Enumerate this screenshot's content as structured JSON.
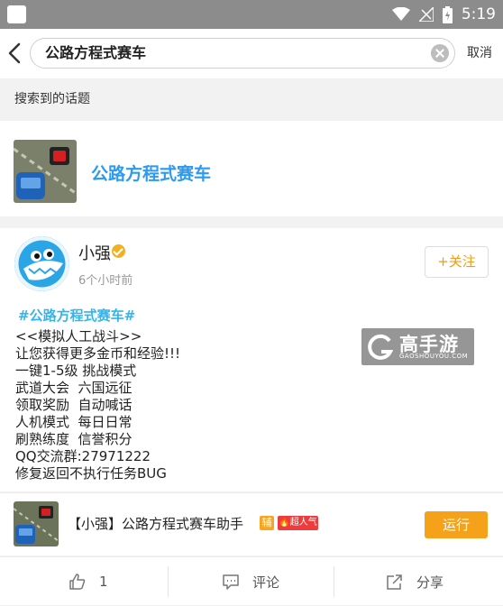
{
  "status_bar": {
    "time": "5:19"
  },
  "search": {
    "query": "公路方程式赛车",
    "cancel_label": "取消"
  },
  "section": {
    "label": "搜索到的话题"
  },
  "topic": {
    "title": "公路方程式赛车"
  },
  "post": {
    "author": "小强",
    "time": "6个小时前",
    "follow_label": "+关注",
    "hashtag": "#公路方程式赛车#",
    "lines": [
      "<<模拟人工战斗>>",
      "让您获得更多金币和经验!!!",
      "一键1-5级 挑战模式",
      "武道大会  六国远征",
      "领取奖励  自动喊话",
      "人机模式  每日日常",
      "刷熟练度  信誉积分",
      "QQ交流群:27971222",
      "修复返回不执行任务BUG"
    ],
    "watermark": {
      "name": "高手游",
      "sub": "GAOSHOUYOU.COM"
    }
  },
  "app": {
    "name": "【小强】公路方程式赛车助手",
    "badge_fu": "辅",
    "badge_hot": "超人气",
    "run_label": "运行"
  },
  "actions": {
    "like_count": "1",
    "comment_label": "评论",
    "share_label": "分享"
  },
  "colors": {
    "accent_blue": "#2b9af3",
    "hashtag_blue": "#2fb6f0",
    "orange": "#f6a11a",
    "status_bar": "#8c8c8c"
  }
}
